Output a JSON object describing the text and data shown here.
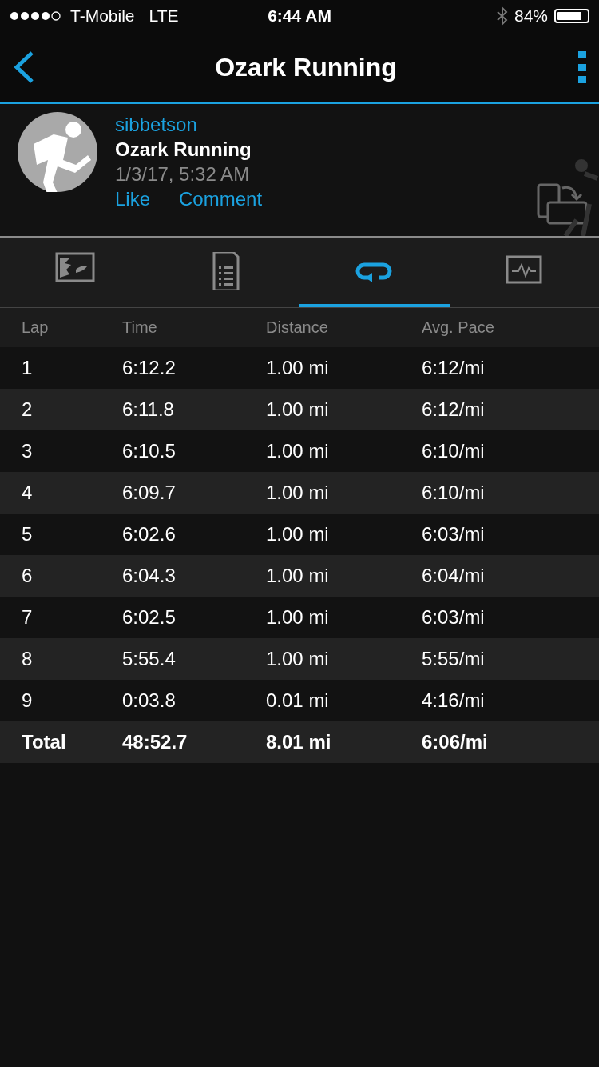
{
  "status_bar": {
    "carrier": "T-Mobile",
    "network": "LTE",
    "time": "6:44 AM",
    "battery_percent": "84%"
  },
  "nav": {
    "title": "Ozark Running"
  },
  "activity": {
    "user": "sibbetson",
    "name": "Ozark Running",
    "date": "1/3/17, 5:32 AM",
    "actions": [
      "Like",
      "Comment"
    ]
  },
  "tabs": [
    {
      "kind": "map",
      "selected": false
    },
    {
      "kind": "summary",
      "selected": false
    },
    {
      "kind": "laps",
      "selected": true
    },
    {
      "kind": "chart",
      "selected": false
    }
  ],
  "table": {
    "columns": [
      "Lap",
      "Time",
      "Distance",
      "Avg. Pace"
    ],
    "rows": [
      [
        "1",
        "6:12.2",
        "1.00 mi",
        "6:12/mi"
      ],
      [
        "2",
        "6:11.8",
        "1.00 mi",
        "6:12/mi"
      ],
      [
        "3",
        "6:10.5",
        "1.00 mi",
        "6:10/mi"
      ],
      [
        "4",
        "6:09.7",
        "1.00 mi",
        "6:10/mi"
      ],
      [
        "5",
        "6:02.6",
        "1.00 mi",
        "6:03/mi"
      ],
      [
        "6",
        "6:04.3",
        "1.00 mi",
        "6:04/mi"
      ],
      [
        "7",
        "6:02.5",
        "1.00 mi",
        "6:03/mi"
      ],
      [
        "8",
        "5:55.4",
        "1.00 mi",
        "5:55/mi"
      ],
      [
        "9",
        "0:03.8",
        "0.01 mi",
        "4:16/mi"
      ]
    ],
    "total": [
      "Total",
      "48:52.7",
      "8.01 mi",
      "6:06/mi"
    ]
  }
}
